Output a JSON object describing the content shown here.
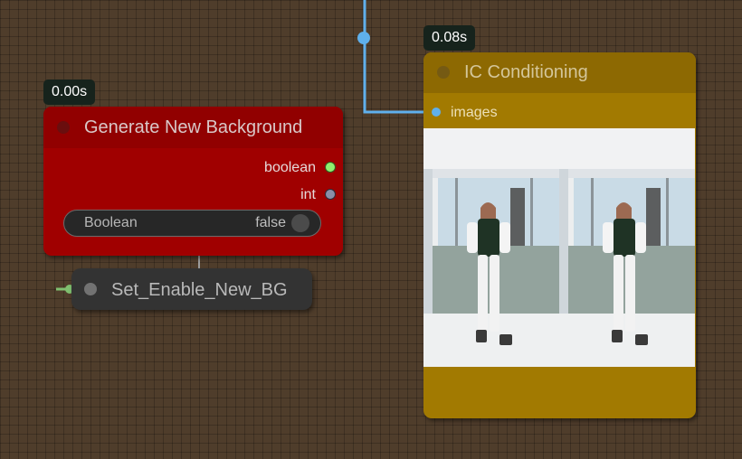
{
  "nodes": {
    "generate_bg": {
      "time": "0.00s",
      "title": "Generate New Background",
      "outputs": [
        "boolean",
        "int"
      ],
      "widget": {
        "name": "Boolean",
        "value": "false"
      }
    },
    "set_node": {
      "title": "Set_Enable_New_BG"
    },
    "ic_conditioning": {
      "time": "0.08s",
      "title": "IC Conditioning",
      "input": "images"
    }
  },
  "colors": {
    "canvas": "#4f3d2b",
    "link_image": "#5fb0ec",
    "link_boolean": "#7fbf6f",
    "node_red": "#a00000",
    "node_gold": "#a27a01",
    "node_dark": "#333333"
  }
}
